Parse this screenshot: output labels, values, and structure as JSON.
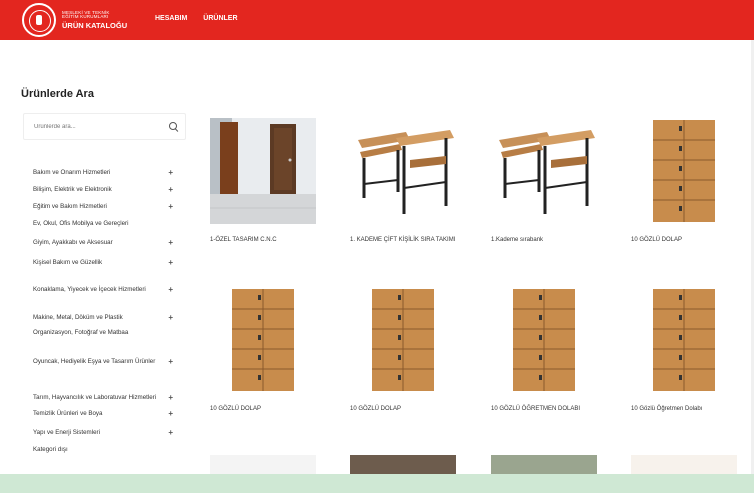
{
  "header": {
    "logo_line1": "MESLEKİ VE TEKNİK",
    "logo_line2": "EĞİTİM KURUMLARI",
    "logo_line3": "ÜRÜN KATALOĞU",
    "nav": [
      "HESABIM",
      "ÜRÜNLER"
    ],
    "bar_color": "#e3261f"
  },
  "sidebar": {
    "title": "Ürünlerde Ara",
    "search_placeholder": "Ürünlerde ara...",
    "categories": [
      {
        "label": "Bakım ve Onarım Hizmetleri",
        "expandable": true
      },
      {
        "label": "Bilişim, Elektrik ve Elektronik",
        "expandable": true
      },
      {
        "label": "Eğitim ve Bakım Hizmetleri",
        "expandable": true
      },
      {
        "label": "Ev, Okul, Ofis Mobilya ve Gereçleri",
        "expandable": false
      },
      {
        "label": "Giyim, Ayakkabı ve Aksesuar",
        "expandable": true
      },
      {
        "label": "Kişisel Bakım ve Güzellik",
        "expandable": true
      },
      {
        "label": "Konaklama, Yiyecek ve İçecek Hizmetleri",
        "expandable": true
      },
      {
        "label": "Makine, Metal, Döküm ve Plastik",
        "expandable": true
      },
      {
        "label": "Organizasyon, Fotoğraf ve Matbaa",
        "expandable": false
      },
      {
        "label": "Oyuncak, Hediyelik Eşya ve Tasarım Ürünler",
        "expandable": true
      },
      {
        "label": "Tarım, Hayvancılık ve Laboratuvar Hizmetleri",
        "expandable": true
      },
      {
        "label": "Temizlik Ürünleri ve Boya",
        "expandable": true
      },
      {
        "label": "Yapı ve Enerji Sistemleri",
        "expandable": true
      },
      {
        "label": "Kategori dışı",
        "expandable": false
      }
    ],
    "plus_symbol": "+"
  },
  "products": [
    {
      "title": "1-ÖZEL TASARIM C.N.C",
      "icon": "door-photo"
    },
    {
      "title": "1. KADEME ÇİFT KİŞİLİK SIRA TAKIMI",
      "icon": "school-desk"
    },
    {
      "title": "1.Kademe sırabank",
      "icon": "school-desk"
    },
    {
      "title": "10 GÖZLÜ DOLAP",
      "icon": "locker"
    },
    {
      "title": "10 GÖZLÜ DOLAP",
      "icon": "locker"
    },
    {
      "title": "10 GÖZLÜ DOLAP",
      "icon": "locker"
    },
    {
      "title": "10 GÖZLÜ ÖĞRETMEN DOLABI",
      "icon": "locker"
    },
    {
      "title": "10 Gözlü Öğretmen Dolabı",
      "icon": "locker"
    }
  ]
}
